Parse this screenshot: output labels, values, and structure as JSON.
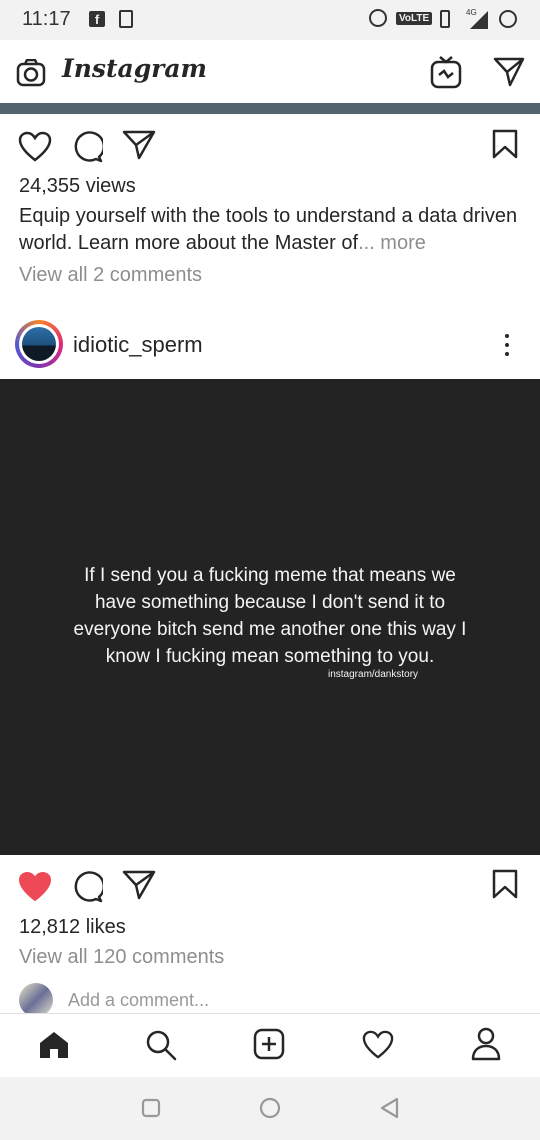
{
  "status_bar": {
    "time": "11:17",
    "volte": "VoLTE",
    "network": "4G"
  },
  "header": {
    "brand": "Instagram"
  },
  "post1": {
    "views": "24,355 views",
    "caption": "Equip yourself with the tools to understand a data driven world. Learn more about the Master of",
    "caption_ellipsis": "...",
    "more": "more",
    "view_comments": "View all 2 comments"
  },
  "post2": {
    "username": "idiotic_sperm",
    "meme_text": "If I send you a fucking meme that means we have something because I don't send it to everyone bitch send me another one this way I know I fucking mean something to you.",
    "meme_credit": "instagram/dankstory",
    "likes": "12,812 likes",
    "view_comments": "View all 120 comments",
    "add_comment_placeholder": "Add a comment...",
    "liked": true
  },
  "bottom_nav": [
    "home-icon",
    "search-icon",
    "new-post-icon",
    "activity-icon",
    "profile-icon"
  ],
  "system_nav": [
    "recents-icon",
    "home-circle-icon",
    "back-icon"
  ],
  "colors": {
    "like_red": "#ed4956",
    "progress_bar": "#556570",
    "meme_bg": "#232323"
  }
}
